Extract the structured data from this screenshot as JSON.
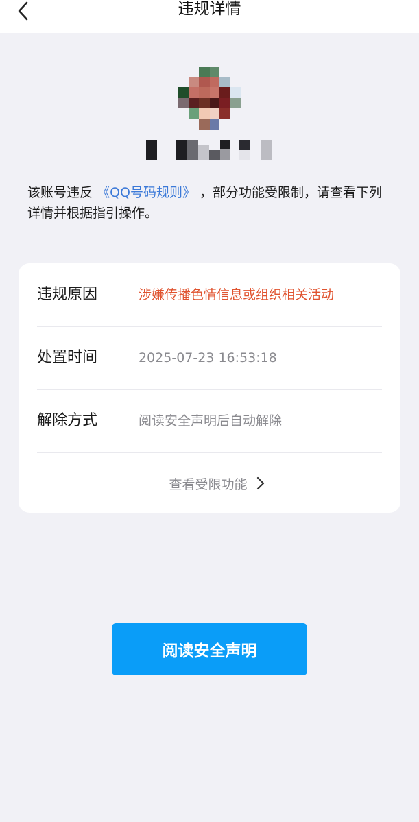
{
  "header": {
    "title": "违规详情",
    "back_icon": "chevron-left-icon"
  },
  "profile": {
    "avatar": "pixelated-avatar",
    "nickname": "pixelated-nickname"
  },
  "notice": {
    "prefix": "该账号违反",
    "link": "《QQ号码规则》",
    "suffix": "，部分功能受限制，请查看下列详情并根据指引操作。"
  },
  "details": {
    "rows": [
      {
        "label": "违规原因",
        "value": "涉嫌传播色情信息或组织相关活动",
        "color": "#e0532f"
      },
      {
        "label": "处置时间",
        "value": "2025-07-23 16:53:18",
        "color": "#8a8a8f"
      },
      {
        "label": "解除方式",
        "value": "阅读安全声明后自动解除",
        "color": "#8a8a8f"
      }
    ],
    "more_label": "查看受限功能",
    "more_icon": "chevron-right-icon"
  },
  "primary_button": {
    "label": "阅读安全声明",
    "color": "#0a9df8"
  }
}
